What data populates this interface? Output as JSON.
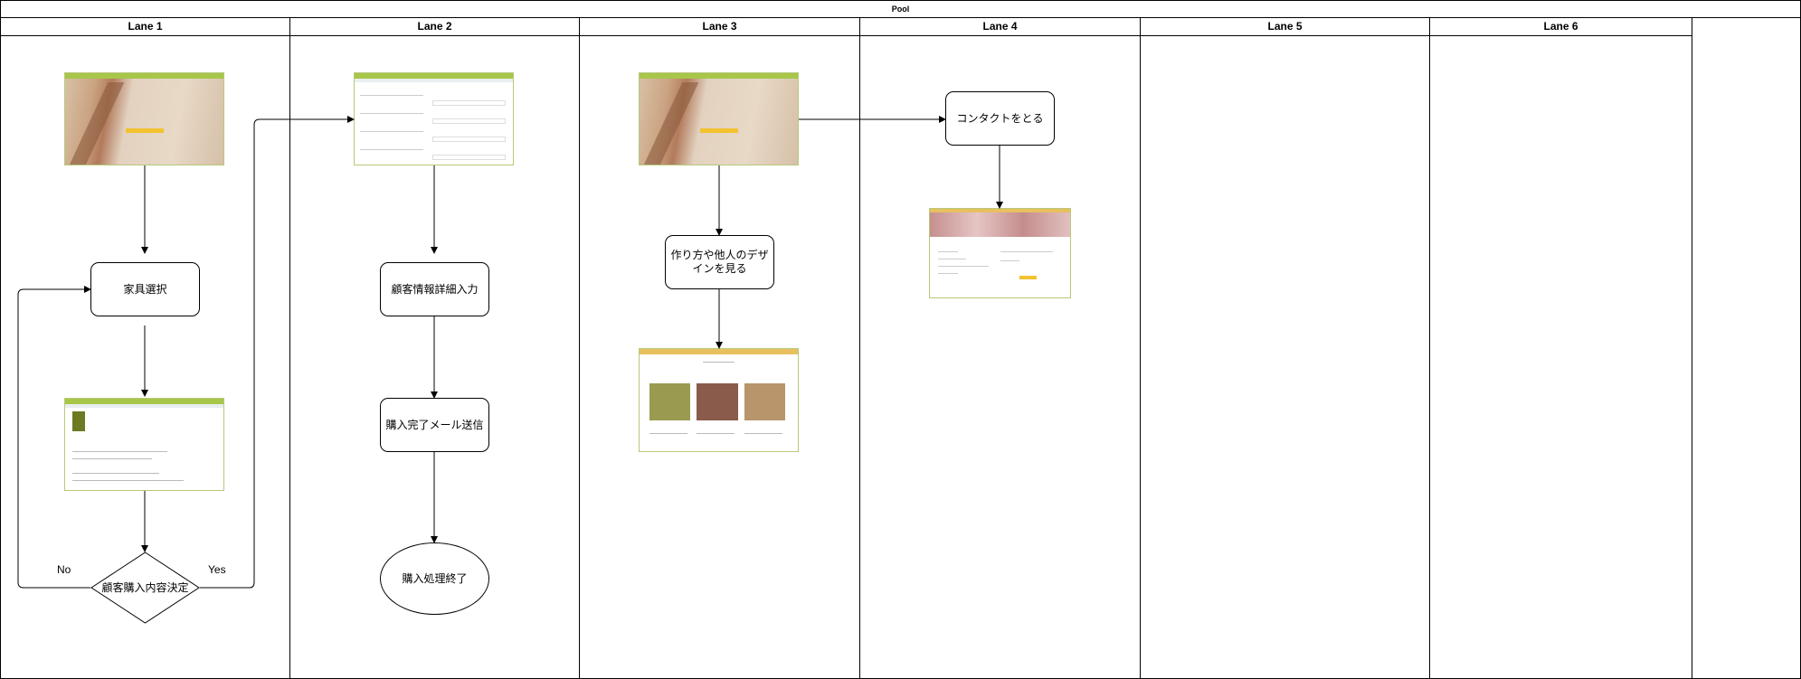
{
  "pool": {
    "title": "Pool"
  },
  "lanes": [
    "Lane 1",
    "Lane 2",
    "Lane 3",
    "Lane 4",
    "Lane 5",
    "Lane 6"
  ],
  "nodes": {
    "select_furniture": "家具選択",
    "decide_purchase": "顧客購入内容決定",
    "customer_info": "顧客情報詳細入力",
    "send_mail": "購入完了メール送信",
    "end_process": "購入処理終了",
    "view_designs": "作り方や他人のデザインを見る",
    "contact": "コンタクトをとる"
  },
  "edge_labels": {
    "no": "No",
    "yes": "Yes"
  },
  "colors": {
    "stroke": "#000000",
    "thumb_bar": "#a7c64a",
    "cta": "#f2c230"
  }
}
